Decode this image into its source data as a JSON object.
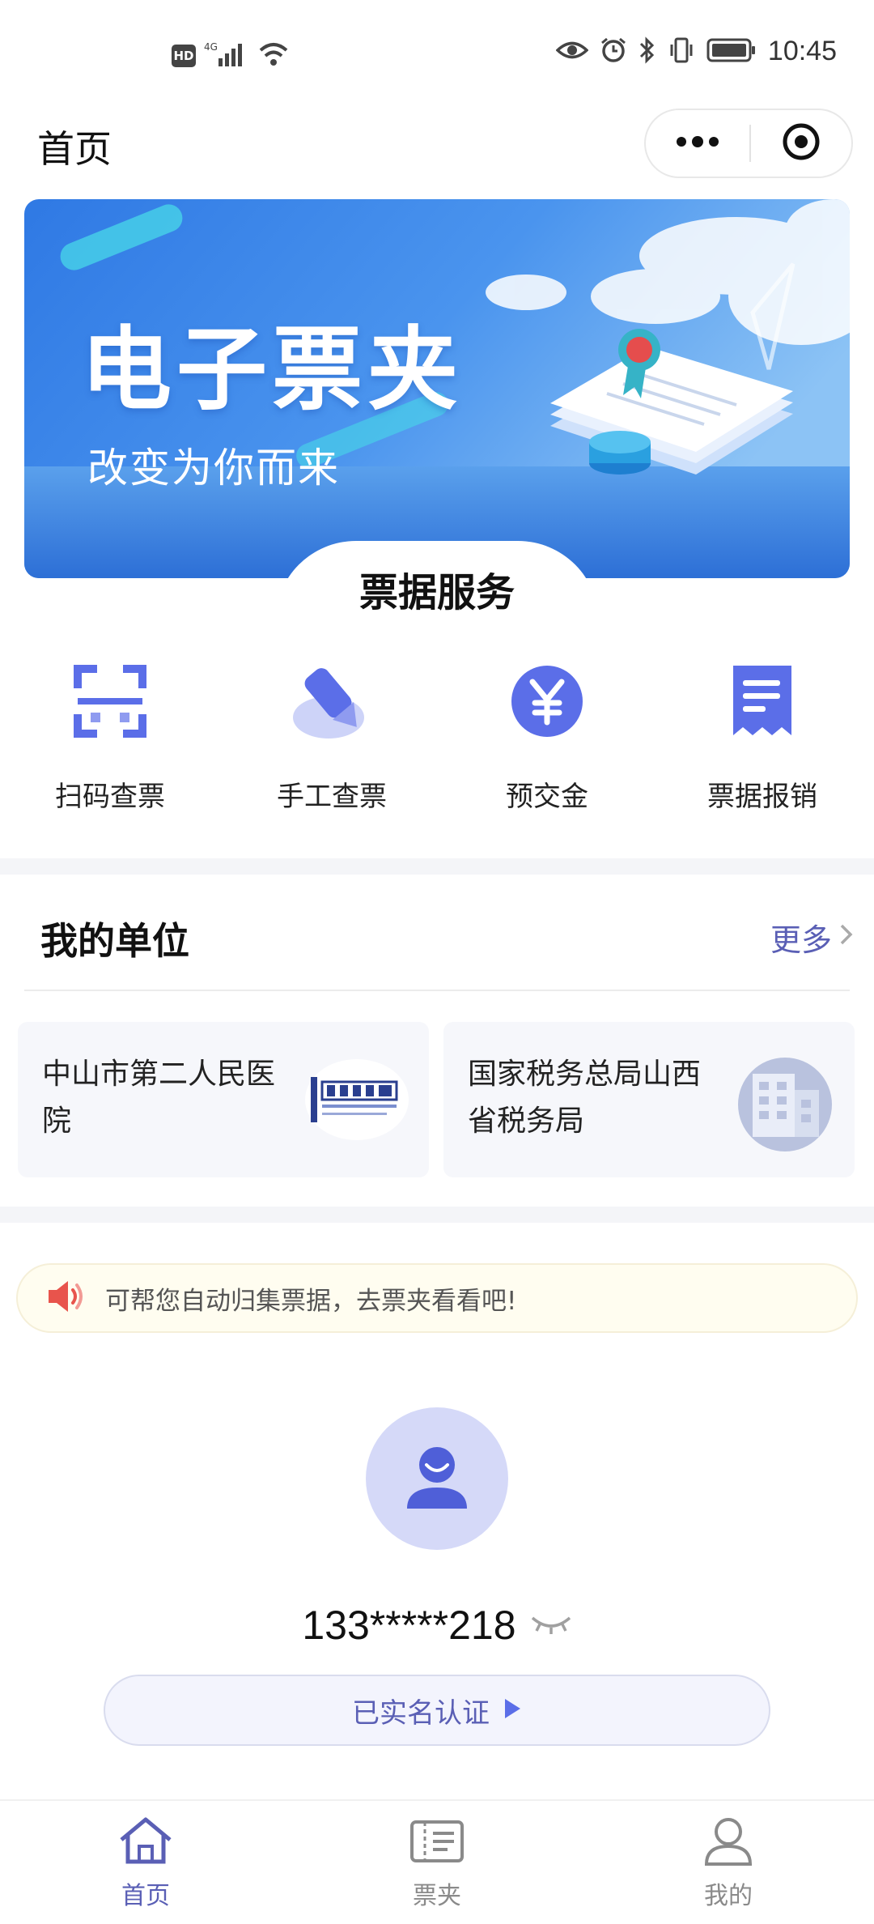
{
  "status_bar": {
    "hd": "HD",
    "network": "4G",
    "time": "10:45"
  },
  "nav": {
    "title": "首页"
  },
  "banner": {
    "title": "电子票夹",
    "subtitle": "改变为你而来"
  },
  "services": {
    "title": "票据服务",
    "items": [
      {
        "label": "扫码查票",
        "icon": "scan-icon"
      },
      {
        "label": "手工查票",
        "icon": "pencil-icon"
      },
      {
        "label": "预交金",
        "icon": "yen-icon"
      },
      {
        "label": "票据报销",
        "icon": "receipt-icon"
      }
    ]
  },
  "units": {
    "title": "我的单位",
    "more": "更多",
    "items": [
      {
        "name": "中山市第二人民医院",
        "logo": "hospital-logo"
      },
      {
        "name": "国家税务总局山西省税务局",
        "logo": "building-icon"
      }
    ]
  },
  "notice": {
    "text": "可帮您自动归集票据，去票夹看看吧!",
    "icon": "speaker-icon"
  },
  "profile": {
    "phone": "133*****218",
    "verify_label": "已实名认证"
  },
  "tabs": [
    {
      "label": "首页",
      "icon": "home-icon",
      "active": true
    },
    {
      "label": "票夹",
      "icon": "ticket-folder-icon",
      "active": false
    },
    {
      "label": "我的",
      "icon": "person-icon",
      "active": false
    }
  ],
  "colors": {
    "accent": "#5a5fb5",
    "icon_blue": "#5b6ee8",
    "banner_blue": "#3f8bea",
    "avatar_bg": "#d5d9f8",
    "notice_bg": "#fffdf0",
    "speaker_red": "#e8544c"
  }
}
